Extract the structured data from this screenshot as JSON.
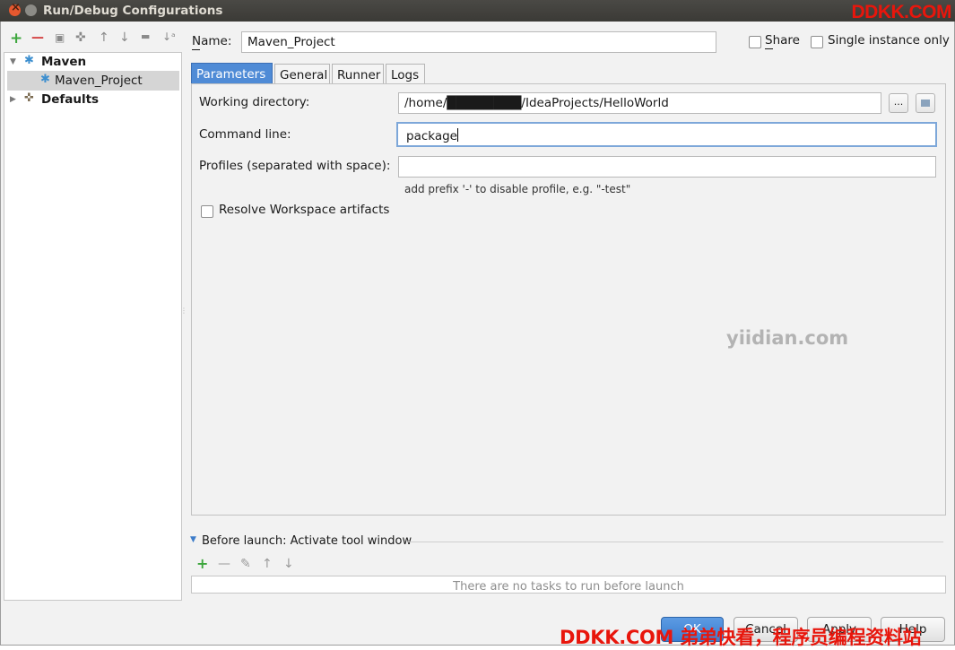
{
  "window": {
    "title": "Run/Debug Configurations"
  },
  "watermarks": {
    "top": "DDKK.COM",
    "center": "yiidian.com",
    "bottom": "DDKK.COM 弟弟快看，程序员编程资料站"
  },
  "toolbar": {
    "add": "+",
    "remove": "—",
    "copy": "▣",
    "wrench": "✜",
    "up": "↑",
    "down": "↓",
    "folder": "▬",
    "sort": "↓ᵃ"
  },
  "tree": {
    "maven_label": "Maven",
    "project_label": "Maven_Project",
    "defaults_label": "Defaults"
  },
  "name_row": {
    "label": "Name:",
    "value": "Maven_Project",
    "share": "Share",
    "single_instance": "Single instance only"
  },
  "tabs": [
    {
      "label": "Parameters"
    },
    {
      "label": "General"
    },
    {
      "label": "Runner"
    },
    {
      "label": "Logs"
    }
  ],
  "params": {
    "working_dir_label": "Working directory:",
    "working_dir_value": "/home/████████/IdeaProjects/HelloWorld",
    "browse_label": "...",
    "command_label": "Command line:",
    "command_value": "package",
    "profiles_label": "Profiles (separated with space):",
    "profiles_value": "",
    "profiles_hint": "add prefix '-' to disable profile, e.g. \"-test\"",
    "resolve_label": "Resolve Workspace artifacts"
  },
  "before_launch": {
    "title": "Before launch: Activate tool window",
    "empty_text": "There are no tasks to run before launch"
  },
  "buttons": {
    "ok": "OK",
    "cancel": "Cancel",
    "apply": "Apply",
    "help": "Help"
  }
}
